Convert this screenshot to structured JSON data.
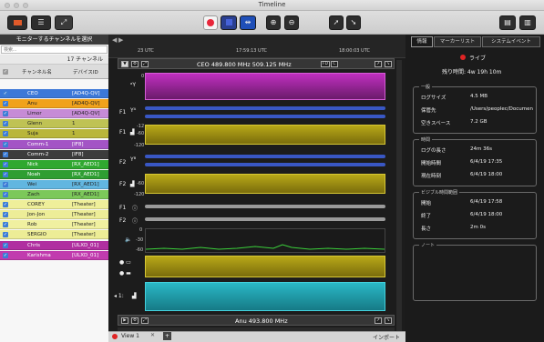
{
  "window": {
    "title": "Timeline"
  },
  "toolbar": {
    "left_icons": [
      "channel-list-icon",
      "list-icon",
      "expand-icon"
    ],
    "center_icons": [
      "record-icon",
      "stop-icon",
      "fit-icon",
      "zoom-in-icon",
      "zoom-out-icon",
      "cursor-icon",
      "marker-cursor-icon"
    ],
    "right_icons": [
      "sidebar-icon",
      "panel-icon"
    ]
  },
  "left": {
    "header": "モニターするチャンネルを選択",
    "search_placeholder": "検索...",
    "count": "17 チャンネル",
    "col_channel": "チャンネル名",
    "col_device": "デバイスID",
    "rows": [
      {
        "name": "CEO",
        "device": "[AD4Q-QV]",
        "color": "#3c78d8",
        "text": "#ffffff"
      },
      {
        "name": "Anu",
        "device": "[AD4Q-QV]",
        "color": "#f0a21c",
        "text": "#222222"
      },
      {
        "name": "Limor",
        "device": "[AD4Q-QV]",
        "color": "#c68bd6",
        "text": "#222222"
      },
      {
        "name": "Glenn",
        "device": "1",
        "color": "#bfc254",
        "text": "#222222"
      },
      {
        "name": "Suja",
        "device": "1",
        "color": "#b9b63a",
        "text": "#222222"
      },
      {
        "name": "Comm-1",
        "device": "[IF8]",
        "color": "#a354c5",
        "text": "#ffffff"
      },
      {
        "name": "Comm-2",
        "device": "[IF8]",
        "color": "#3c3c3c",
        "text": "#ffffff"
      },
      {
        "name": "Nick",
        "device": "[RX_AED1]",
        "color": "#30a830",
        "text": "#ffffff"
      },
      {
        "name": "Noah",
        "device": "[RX_AED1]",
        "color": "#2f9e32",
        "text": "#ffffff"
      },
      {
        "name": "Wei",
        "device": "[RX_AED1]",
        "color": "#62b6e0",
        "text": "#222222"
      },
      {
        "name": "Zach",
        "device": "[RX_AED1]",
        "color": "#7cc85a",
        "text": "#222222"
      },
      {
        "name": "COREY",
        "device": "[Theater]",
        "color": "#efef9a",
        "text": "#222222"
      },
      {
        "name": "Jon-Jon",
        "device": "[Theater]",
        "color": "#eded98",
        "text": "#222222"
      },
      {
        "name": "Rob",
        "device": "[Theater]",
        "color": "#f0f0a0",
        "text": "#222222"
      },
      {
        "name": "SERGIO",
        "device": "[Theater]",
        "color": "#eded96",
        "text": "#222222"
      },
      {
        "name": "Chris",
        "device": "[ULXD_01]",
        "color": "#b02fa0",
        "text": "#ffffff"
      },
      {
        "name": "Karishma",
        "device": "[ULXD_01]",
        "color": "#c13bae",
        "text": "#ffffff"
      }
    ]
  },
  "center": {
    "times": [
      "23 UTC",
      "17:59:13 UTC",
      "18:00:03 UTC"
    ],
    "group1_title": "CEO  489.800 MHz  509.125 MHz",
    "group1_badges": [
      "FD",
      "C"
    ],
    "f1": "F1",
    "f2": "F2",
    "ticks_top": [
      "-12",
      "-60",
      "-120"
    ],
    "ticks_mid": [
      "-60",
      "-120"
    ],
    "meter_ticks": [
      "0",
      "-30",
      "-60"
    ],
    "group2_title": "Anu  493.800 MHz",
    "hidden_text": "Anu  493.800 MHz"
  },
  "right": {
    "tabs": [
      "情報",
      "マーカーリスト",
      "システムイベント"
    ],
    "live": "ライブ",
    "remaining": "残り時間: 4w 19h 10m",
    "general": {
      "title": "一般",
      "rows": [
        {
          "k": "ログサイズ",
          "v": "4.5 MB"
        },
        {
          "k": "保管先",
          "v": "/Users/peoplec/Documen"
        },
        {
          "k": "空きスペース",
          "v": "7.2 GB"
        }
      ]
    },
    "time": {
      "title": "時間",
      "rows": [
        {
          "k": "ログの長さ",
          "v": "24m 36s"
        },
        {
          "k": "開始時間",
          "v": "6/4/19 17:35"
        },
        {
          "k": "現在時刻",
          "v": "6/4/19 18:00"
        }
      ]
    },
    "visible": {
      "title": "ビジブル時間範囲",
      "rows": [
        {
          "k": "開始",
          "v": "6/4/19 17:58"
        },
        {
          "k": "終了",
          "v": "6/4/19 18:00"
        },
        {
          "k": "長さ",
          "v": "2m 0s"
        }
      ]
    },
    "notes": {
      "title": "ノート"
    }
  },
  "bottom": {
    "view_tab": "View 1",
    "import": "インポート"
  }
}
